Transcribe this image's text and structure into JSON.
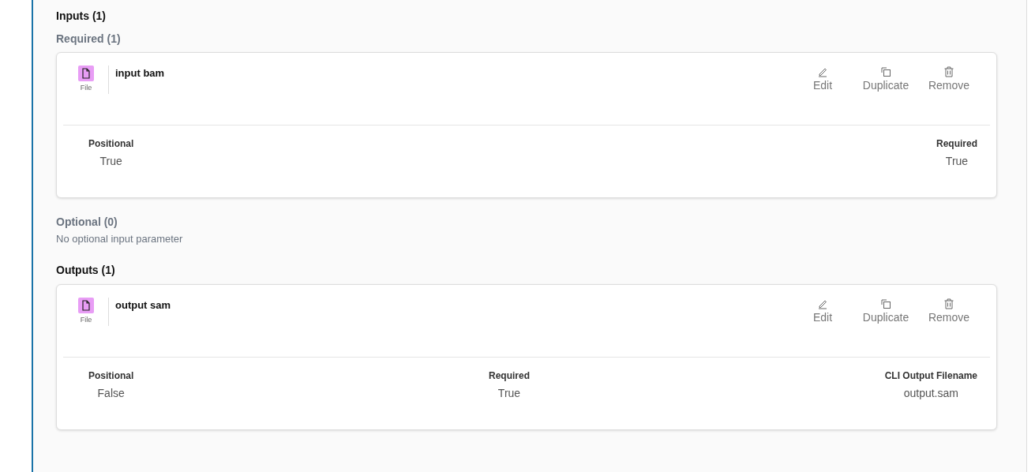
{
  "inputs": {
    "title": "Inputs (1)",
    "groups": [
      {
        "title": "Required (1)",
        "params": [
          {
            "type_label": "File",
            "name": "input bam",
            "actions": [
              {
                "kind": "edit",
                "label": "Edit"
              },
              {
                "kind": "duplicate",
                "label": "Duplicate"
              },
              {
                "kind": "remove",
                "label": "Remove"
              }
            ],
            "properties": [
              {
                "label": "Positional",
                "value": "True"
              },
              {
                "label": "Required",
                "value": "True"
              }
            ]
          }
        ]
      },
      {
        "title": "Optional (0)",
        "empty_text": "No optional input parameter"
      }
    ]
  },
  "outputs": {
    "title": "Outputs (1)",
    "params": [
      {
        "type_label": "File",
        "name": "output sam",
        "actions": [
          {
            "kind": "edit",
            "label": "Edit"
          },
          {
            "kind": "duplicate",
            "label": "Duplicate"
          },
          {
            "kind": "remove",
            "label": "Remove"
          }
        ],
        "properties": [
          {
            "label": "Positional",
            "value": "False"
          },
          {
            "label": "Required",
            "value": "True"
          },
          {
            "label": "CLI Output Filename",
            "value": "output.sam"
          }
        ]
      }
    ]
  }
}
